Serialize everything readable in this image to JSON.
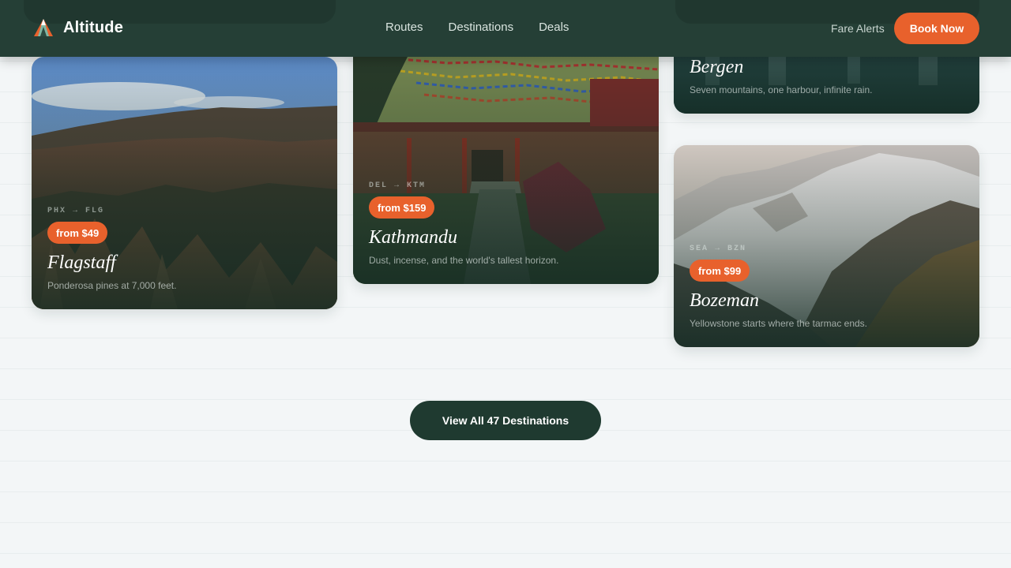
{
  "header": {
    "brand": "Altitude",
    "logo_icon": "mountain-logo-icon",
    "nav": [
      "Routes",
      "Destinations",
      "Deals"
    ],
    "fare_alerts": "Fare Alerts",
    "book_now": "Book Now"
  },
  "cards": [
    {
      "city": "Flagstaff",
      "route": "PHX → FLG",
      "price": "from $49",
      "tagline": "Ponderosa pines at 7,000 feet."
    },
    {
      "city": "Kathmandu",
      "route": "DEL → KTM",
      "price": "from $159",
      "tagline": "Dust, incense, and the world's tallest horizon."
    },
    {
      "city": "Bergen",
      "tagline": "Seven mountains, one harbour, infinite rain."
    },
    {
      "city": "Bozeman",
      "route": "SEA → BZN",
      "price": "from $99",
      "tagline": "Yellowstone starts where the tarmac ends."
    }
  ],
  "view_all": "View All 47 Destinations",
  "colors": {
    "header_bg": "#253f36",
    "accent": "#e8612c",
    "dark_button": "#1f3a30",
    "page_bg": "#f3f6f7"
  }
}
